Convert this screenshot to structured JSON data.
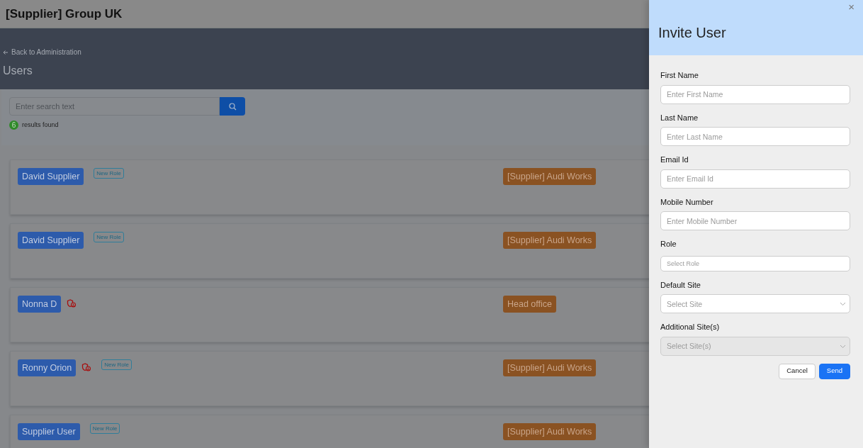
{
  "header": {
    "title": "[Supplier] Group UK"
  },
  "back_link": "Back to Administration",
  "page_title": "Users",
  "search": {
    "placeholder": "Enter search text"
  },
  "results": {
    "count": "6",
    "label": "results found"
  },
  "users": [
    {
      "name": "David Supplier",
      "flagged": false,
      "role_tag": "New Role",
      "site": "[Supplier] Audi Works"
    },
    {
      "name": "David Supplier",
      "flagged": false,
      "role_tag": "New Role",
      "site": "[Supplier] Audi Works"
    },
    {
      "name": "Nonna D",
      "flagged": true,
      "site": "Head office"
    },
    {
      "name": "Ronny Orion",
      "flagged": true,
      "role_tag": "New Role",
      "site": "[Supplier] Audi Works"
    },
    {
      "name": "Supplier User",
      "flagged": false,
      "role_tag": "New Role",
      "site": "[Supplier] Audi Works"
    }
  ],
  "dialog": {
    "title": "Invite User",
    "close": "×",
    "fields": [
      {
        "label": "First Name",
        "placeholder": "Enter First Name",
        "kind": "text",
        "disabled": false
      },
      {
        "label": "Last Name",
        "placeholder": "Enter Last Name",
        "kind": "text",
        "disabled": false
      },
      {
        "label": "Email Id",
        "placeholder": "Enter Email Id",
        "kind": "text",
        "disabled": false
      },
      {
        "label": "Mobile Number",
        "placeholder": "Enter Mobile Number",
        "kind": "text",
        "disabled": false
      },
      {
        "label": "Role",
        "placeholder": "Select Role",
        "kind": "compact",
        "disabled": false
      },
      {
        "label": "Default Site",
        "placeholder": "Select Site",
        "kind": "dropdown",
        "disabled": false
      },
      {
        "label": "Additional Site(s)",
        "placeholder": "Select Site(s)",
        "kind": "dropdown",
        "disabled": true
      }
    ],
    "buttons": [
      {
        "label": "Cancel",
        "kind": "secondary"
      },
      {
        "label": "Send",
        "kind": "primary"
      }
    ]
  }
}
